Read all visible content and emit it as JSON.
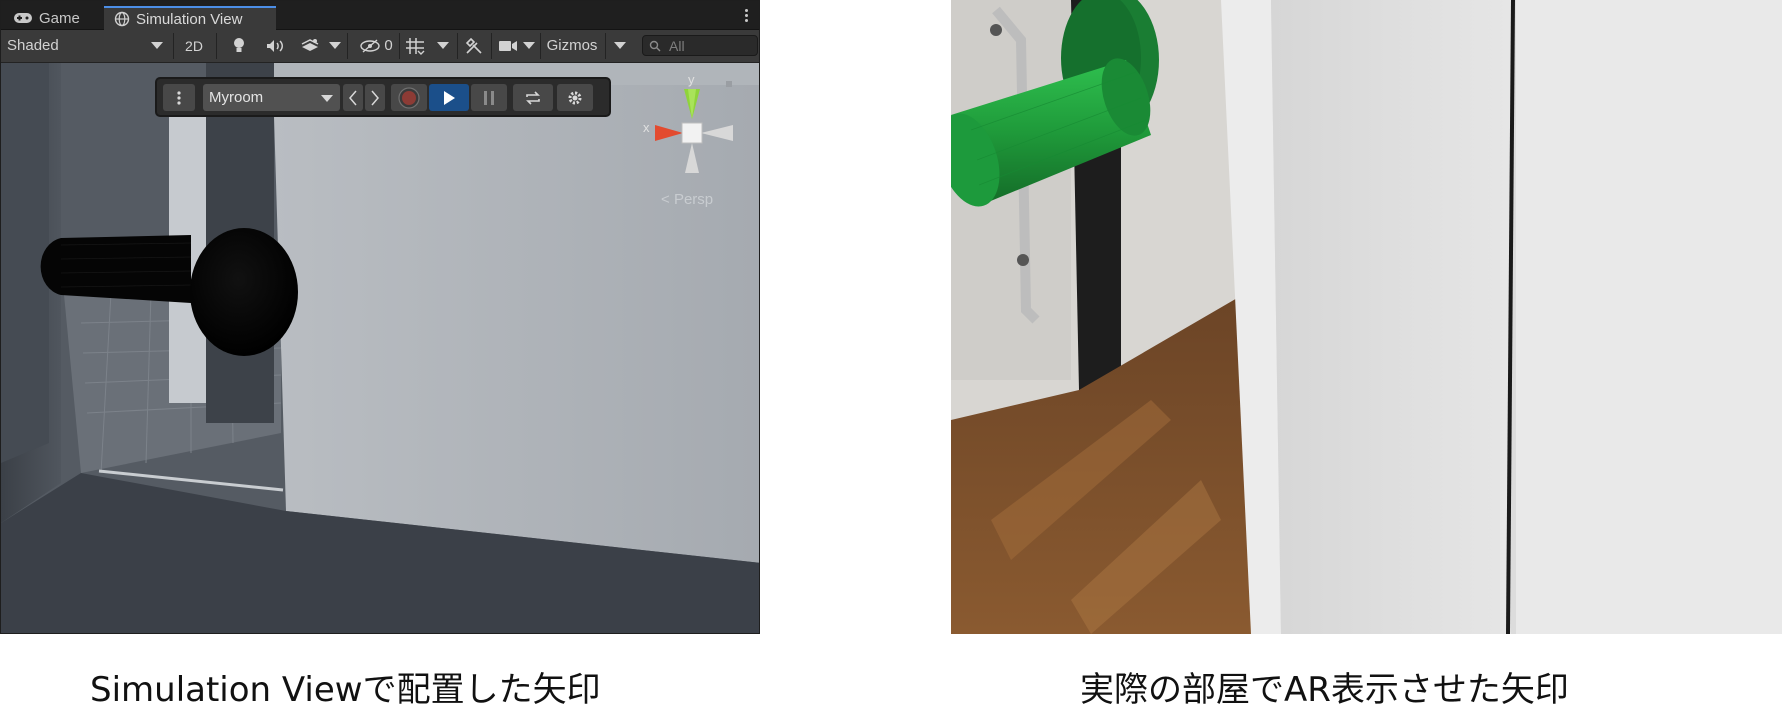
{
  "tabs": [
    {
      "label": "Game",
      "icon": "gamepad-icon"
    },
    {
      "label": "Simulation View",
      "icon": "globe-icon"
    }
  ],
  "toolbar": {
    "shading_mode": "Shaded",
    "view_2d_label": "2D",
    "hidden_count": "0",
    "gizmos_label": "Gizmos",
    "search_placeholder": "All"
  },
  "overlay": {
    "environment": "Myroom"
  },
  "scene_gizmo": {
    "y_label": "y",
    "x_label": "x",
    "projection_label": "Persp"
  },
  "captions": {
    "left": "Simulation Viewで配置した矢印",
    "right": "実際の部屋でAR表示させた矢印"
  },
  "colors": {
    "editor_dark": "#1f1f1f",
    "editor_toolbar": "#3a3a3a",
    "accent_blue": "#4c8ee6",
    "play_active": "#1b4f8a",
    "arrow_sim": "#000000",
    "arrow_ar": "#1f9a3a"
  }
}
